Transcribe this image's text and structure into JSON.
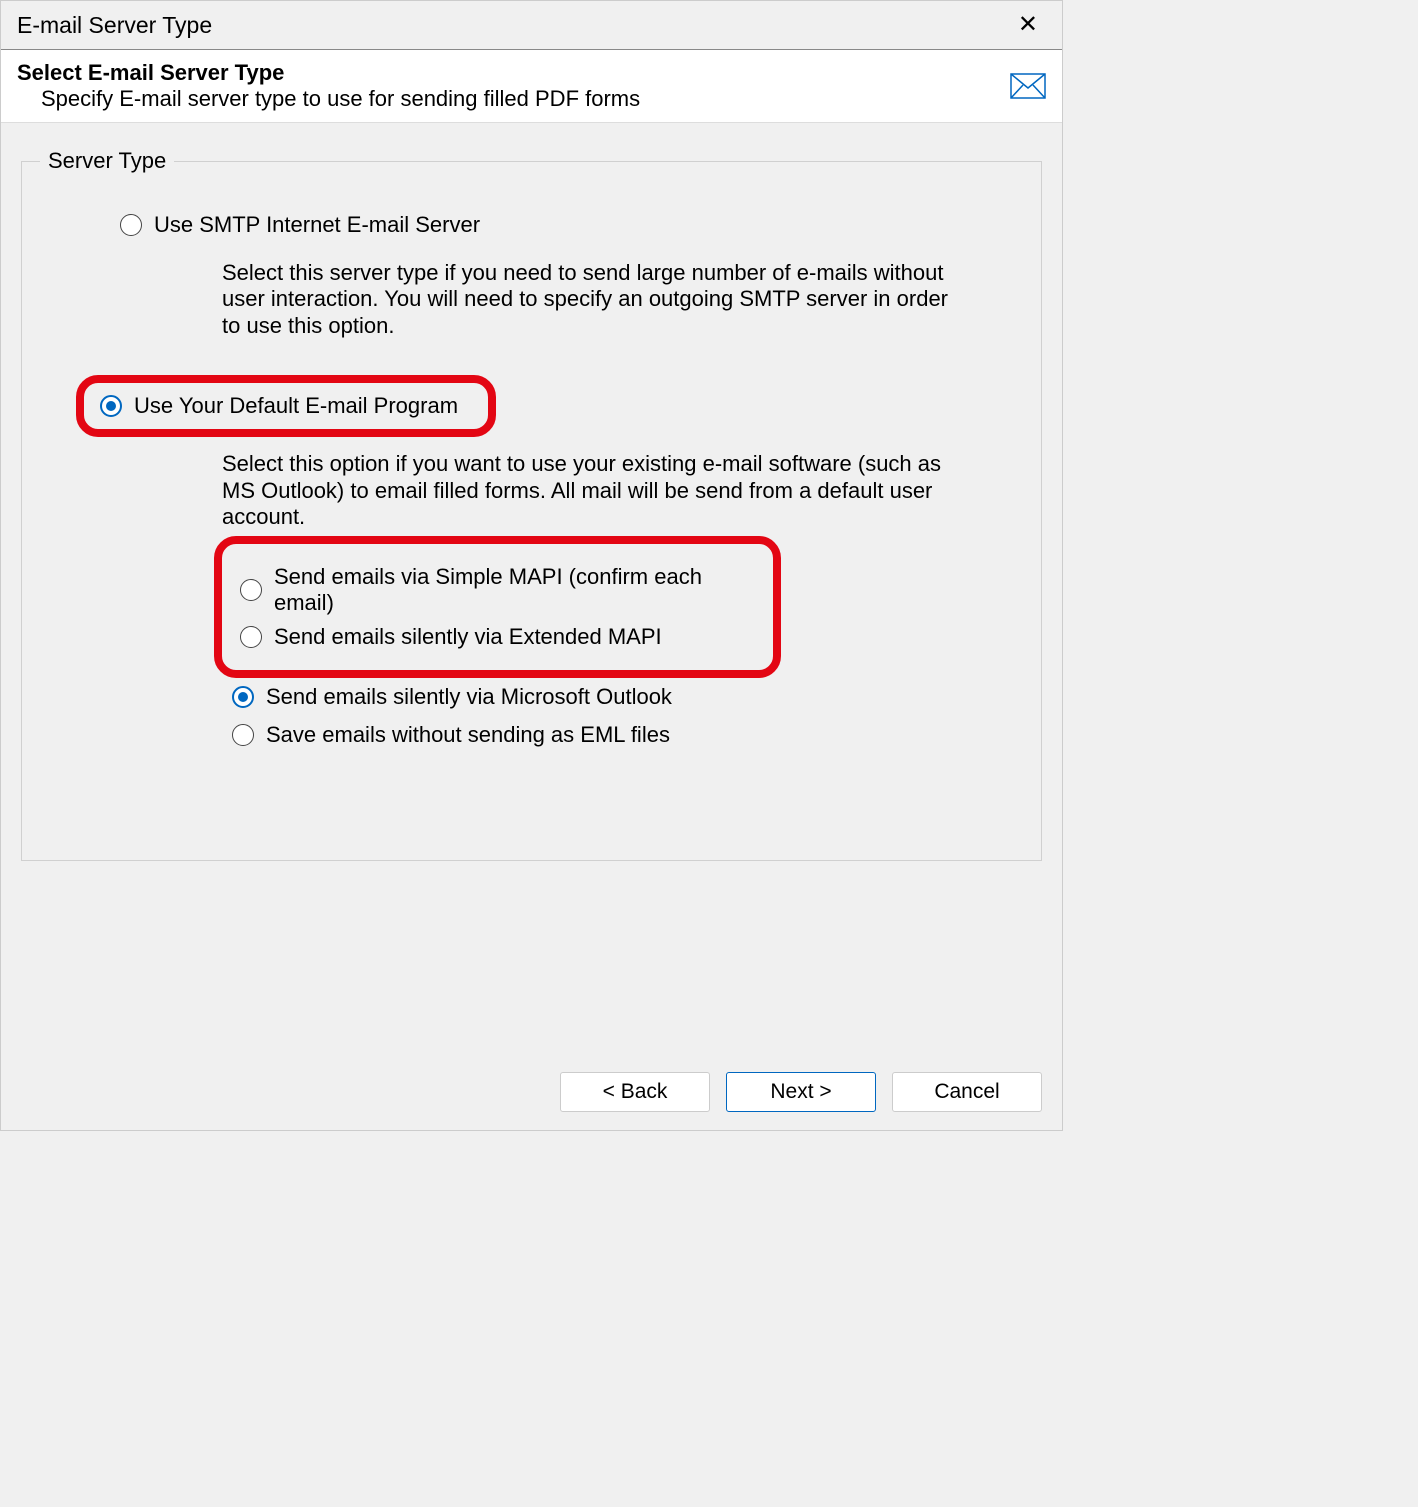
{
  "titlebar": {
    "title": "E-mail Server Type"
  },
  "header": {
    "title": "Select E-mail Server Type",
    "subtitle": "Specify E-mail server type to use for sending filled PDF forms"
  },
  "group": {
    "title": "Server Type"
  },
  "options": {
    "smtp": {
      "label": "Use SMTP Internet E-mail Server",
      "description": "Select this server type if you need to send large number of e-mails without user interaction. You will need to specify an outgoing SMTP server in order to use this option."
    },
    "default_program": {
      "label": "Use Your Default E-mail Program",
      "description": "Select this option if you want to use your existing e-mail software (such as MS Outlook) to email filled forms. All mail will be send from a default user account.",
      "sub": {
        "simple_mapi": "Send emails via Simple MAPI (confirm each email)",
        "extended_mapi": "Send emails silently via Extended MAPI",
        "outlook": "Send emails silently via Microsoft Outlook",
        "eml": "Save emails without sending as EML files"
      }
    }
  },
  "buttons": {
    "back": "< Back",
    "next": "Next >",
    "cancel": "Cancel"
  }
}
